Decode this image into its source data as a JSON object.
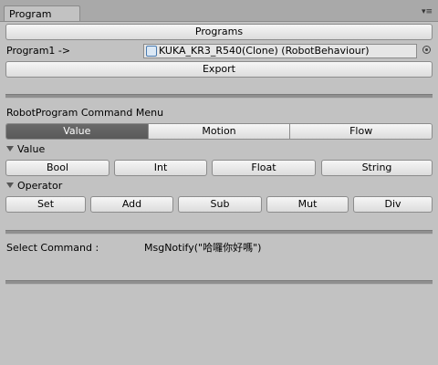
{
  "tab": {
    "title": "Program"
  },
  "header": {
    "programs_button": "Programs",
    "program_label": "Program1 ->",
    "robot_field": "KUKA_KR3_R540(Clone) (RobotBehaviour)",
    "export_button": "Export"
  },
  "menu": {
    "title": "RobotProgram Command Menu",
    "tabs": [
      {
        "label": "Value",
        "active": true
      },
      {
        "label": "Motion",
        "active": false
      },
      {
        "label": "Flow",
        "active": false
      }
    ]
  },
  "value_section": {
    "title": "Value",
    "buttons": [
      "Bool",
      "Int",
      "Float",
      "String"
    ]
  },
  "operator_section": {
    "title": "Operator",
    "buttons": [
      "Set",
      "Add",
      "Sub",
      "Mut",
      "Div"
    ]
  },
  "selection": {
    "label": "Select Command :",
    "value": "MsgNotify(\"哈囉你好嗎\")"
  },
  "colors": {
    "active_tab": "#5f5f5f",
    "panel": "#c2c2c2"
  },
  "icons": [
    "menu-icon",
    "object-icon",
    "target-icon",
    "foldout-arrow-icon"
  ]
}
